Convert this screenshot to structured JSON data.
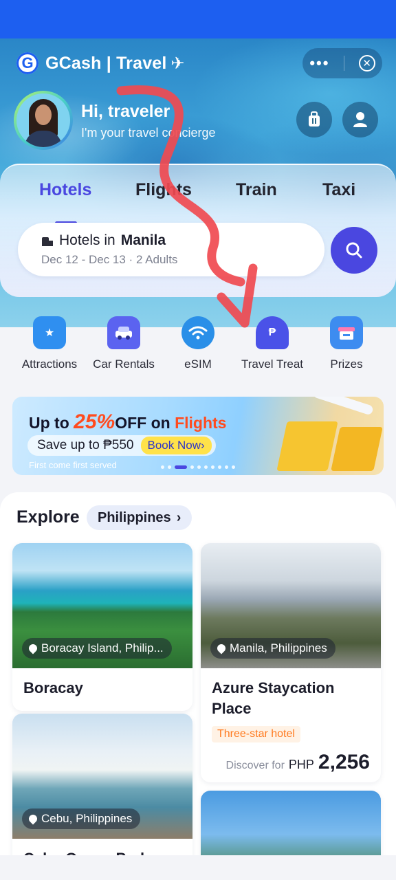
{
  "header": {
    "brand": "GCash | Travel",
    "plane_glyph": "✈",
    "more_icon": "more-dots-icon",
    "close_icon": "close-icon"
  },
  "profile": {
    "greeting": "Hi, traveler",
    "subtitle": "I'm your travel concierge"
  },
  "tabs": [
    {
      "label": "Hotels",
      "active": true
    },
    {
      "label": "Flights",
      "active": false
    },
    {
      "label": "Train",
      "active": false
    },
    {
      "label": "Taxi",
      "active": false
    }
  ],
  "search": {
    "line_prefix": "Hotels in",
    "city": "Manila",
    "details": "Dec 12 - Dec 13 · 2 Adults"
  },
  "quick_actions": [
    {
      "label": "Attractions",
      "icon": "attractions-icon",
      "color": "#2f8ff0"
    },
    {
      "label": "Car Rentals",
      "icon": "car-icon",
      "color": "#5b63f0"
    },
    {
      "label": "eSIM",
      "icon": "wifi-icon",
      "color": "#2a8fe8"
    },
    {
      "label": "Travel Treat",
      "icon": "treat-icon",
      "color": "#4a52e8"
    },
    {
      "label": "Prizes",
      "icon": "gift-icon",
      "color": "#3d8cf0"
    }
  ],
  "banner": {
    "title_a": "Up to ",
    "title_pct": "25%",
    "title_b": "OFF on ",
    "title_c": "Flights",
    "save": "Save up to ₱550",
    "cta": "Book Now",
    "cta_glyph": "›",
    "note": "First come first served"
  },
  "explore": {
    "title": "Explore",
    "location": "Philippines",
    "chevron": "›",
    "cards": [
      {
        "location": "Boracay Island, Philip...",
        "name": "Boracay"
      },
      {
        "location": "Manila, Philippines",
        "name": "Azure Staycation Place",
        "tag": "Three-star hotel",
        "price_label": "Discover for",
        "currency": "PHP",
        "price": "2,256"
      },
      {
        "location": "Cebu, Philippines",
        "name": "Cebu Ocean Park"
      }
    ]
  },
  "colors": {
    "brand_blue": "#1d5ff0",
    "accent_purple": "#4a47e0",
    "annotation_red": "#f04a50"
  }
}
